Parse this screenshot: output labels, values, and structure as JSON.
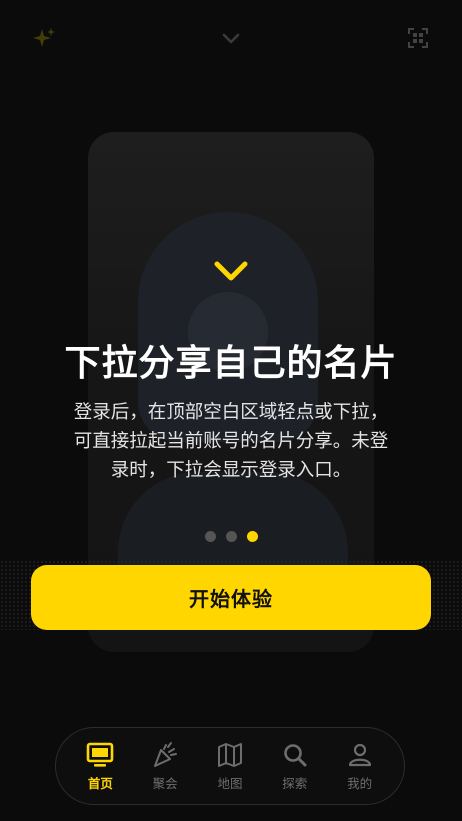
{
  "topbar": {
    "left_icon": "sparkle-icon",
    "center_icon": "chevron-down-icon",
    "right_icon": "scan-icon"
  },
  "onboarding": {
    "hint_icon": "chevron-down-icon",
    "title": "下拉分享自己的名片",
    "description_lines": [
      "登录后，在顶部空白区域轻点或下拉，",
      "可直接拉起当前账号的名片分享。未登",
      "录时，下拉会显示登录入口。"
    ],
    "page_count": 3,
    "active_page": 3,
    "start_button_label": "开始体验"
  },
  "tabbar": {
    "items": [
      {
        "label": "首页",
        "icon": "tv-icon",
        "active": true
      },
      {
        "label": "聚会",
        "icon": "party-popper-icon",
        "active": false
      },
      {
        "label": "地图",
        "icon": "map-icon",
        "active": false
      },
      {
        "label": "探索",
        "icon": "search-icon",
        "active": false
      },
      {
        "label": "我的",
        "icon": "person-icon",
        "active": false
      }
    ]
  },
  "colors": {
    "accent": "#ffd600",
    "background": "#0b0b0b",
    "inactive": "#6d6d6d"
  }
}
